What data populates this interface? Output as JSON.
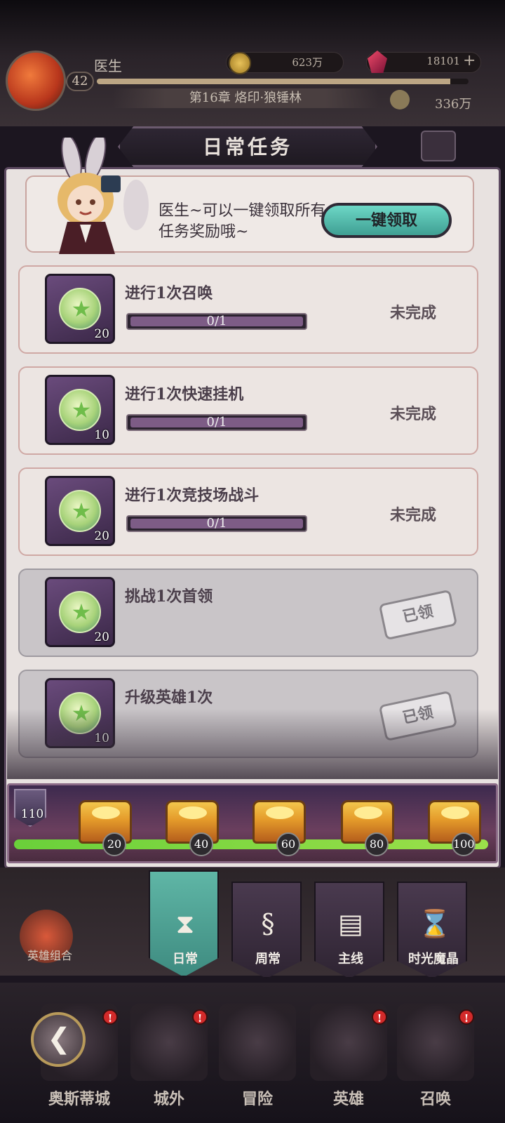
{
  "header": {
    "player_name": "医生",
    "level": "42",
    "xp_progress": 0.95,
    "gold": "623万",
    "gems": "18101",
    "gem_plus": "+",
    "chapter": "第16章 烙印·狼锤林",
    "power": "336万"
  },
  "panel": {
    "title": "日常任务",
    "helper_text": "医生~可以一键领取所有任务奖励哦~",
    "claim_all_label": "一键领取"
  },
  "tasks": [
    {
      "title": "进行1次召唤",
      "reward_qty": "20",
      "progress": "0/1",
      "status": "未完成",
      "claimed": false
    },
    {
      "title": "进行1次快速挂机",
      "reward_qty": "10",
      "progress": "0/1",
      "status": "未完成",
      "claimed": false
    },
    {
      "title": "进行1次竞技场战斗",
      "reward_qty": "20",
      "progress": "0/1",
      "status": "未完成",
      "claimed": false
    },
    {
      "title": "挑战1次首领",
      "reward_qty": "20",
      "stamp": "已领",
      "claimed": true
    },
    {
      "title": "升级英雄1次",
      "reward_qty": "10",
      "stamp": "已领",
      "claimed": true
    }
  ],
  "activity": {
    "points": "110",
    "progress": 1.0,
    "milestones": [
      "20",
      "40",
      "60",
      "80",
      "100"
    ]
  },
  "tabs": [
    {
      "label": "日常",
      "icon": "scroll-hourglass-icon",
      "active": true
    },
    {
      "label": "周常",
      "icon": "scroll-icon",
      "active": false
    },
    {
      "label": "主线",
      "icon": "book-icon",
      "active": false
    },
    {
      "label": "时光魔晶",
      "icon": "hourglass-icon",
      "active": false
    }
  ],
  "side_menu": {
    "hero_combo": "英雄组合"
  },
  "bottom_nav": {
    "items": [
      "奥斯蒂城",
      "城外",
      "冒险",
      "英雄",
      "召唤"
    ],
    "badge": "!"
  },
  "colors": {
    "panel_bg": "#e8e2e0",
    "accent_teal": "#5fb6a6",
    "progress_purple": "#7d5c86",
    "activity_green": "#6ad03a"
  }
}
